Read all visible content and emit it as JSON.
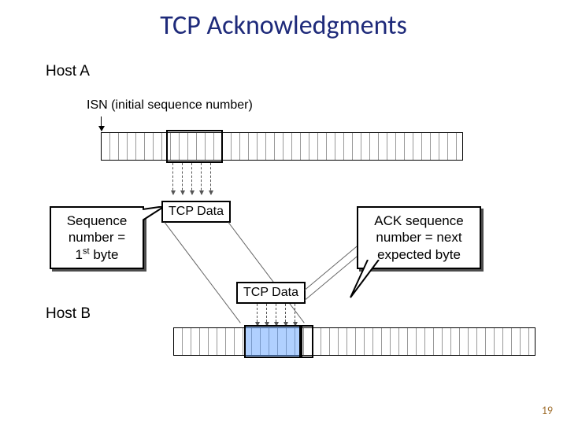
{
  "title": "TCP Acknowledgments",
  "hostA": "Host A",
  "hostB": "Host B",
  "isn_label": "ISN (initial sequence number)",
  "seq_callout_l1": "Sequence",
  "seq_callout_l2": "number =",
  "seq_callout_l3a": "1",
  "seq_callout_l3b": "st",
  "seq_callout_l3c": " byte",
  "ack_callout_l1": "ACK sequence",
  "ack_callout_l2": "number = next",
  "ack_callout_l3": "expected byte",
  "tcp_data": "TCP Data",
  "page": "19"
}
